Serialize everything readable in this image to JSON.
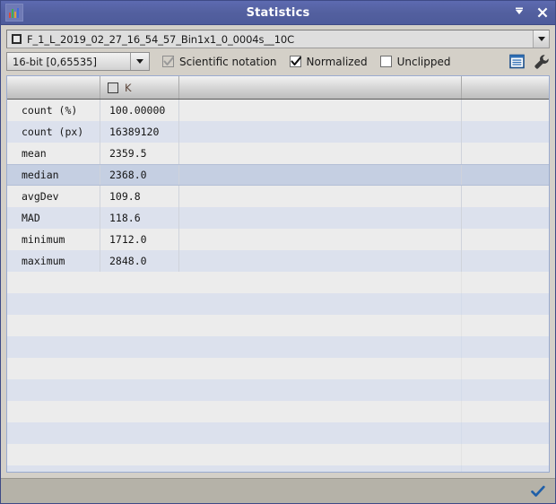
{
  "window": {
    "title": "Statistics",
    "app_icon": "histogram-icon",
    "buttons": [
      {
        "name": "shade-button",
        "icon": "roll-up-icon"
      },
      {
        "name": "close-button",
        "icon": "close-icon"
      }
    ]
  },
  "path_bar": {
    "icon": "image-window-icon",
    "value": "F_1_L_2019_02_27_16_54_57_Bin1x1_0_0004s__10C",
    "dropdown_icon": "chevron-down-icon"
  },
  "options": {
    "range_combo": {
      "value": "16-bit [0,65535]",
      "dropdown_icon": "chevron-down-icon"
    },
    "checkboxes": [
      {
        "label": "Scientific notation",
        "checked": true,
        "enabled": false
      },
      {
        "label": "Normalized",
        "checked": true,
        "enabled": true
      },
      {
        "label": "Unclipped",
        "checked": false,
        "enabled": true
      }
    ],
    "tool_icons": [
      {
        "name": "text-report-icon"
      },
      {
        "name": "wrench-icon"
      }
    ]
  },
  "table": {
    "columns": [
      {
        "label": "",
        "has_checkbox": false
      },
      {
        "label": "K",
        "has_checkbox": true,
        "checked": false
      },
      {
        "label": "",
        "has_checkbox": false
      },
      {
        "label": "",
        "has_checkbox": false
      }
    ],
    "rows": [
      {
        "name": "count (%)",
        "value": "100.00000",
        "selected": false
      },
      {
        "name": "count (px)",
        "value": "16389120",
        "selected": false
      },
      {
        "name": "mean",
        "value": "2359.5",
        "selected": false
      },
      {
        "name": "median",
        "value": "2368.0",
        "selected": true
      },
      {
        "name": "avgDev",
        "value": "109.8",
        "selected": false
      },
      {
        "name": "MAD",
        "value": "118.6",
        "selected": false
      },
      {
        "name": "minimum",
        "value": "1712.0",
        "selected": false
      },
      {
        "name": "maximum",
        "value": "2848.0",
        "selected": false
      }
    ],
    "empty_row_count": 10
  },
  "status_bar": {
    "icon": "blue-checkmark-icon",
    "accent_color": "#1f5fa8"
  },
  "colors": {
    "titlebar": "#53609f",
    "frame": "#5260a8",
    "client": "#d4d0c8",
    "row_even": "#ececec",
    "row_odd": "#dce1ed",
    "row_selected": "#c5cfe2",
    "status_bar": "#b5b2a8"
  }
}
